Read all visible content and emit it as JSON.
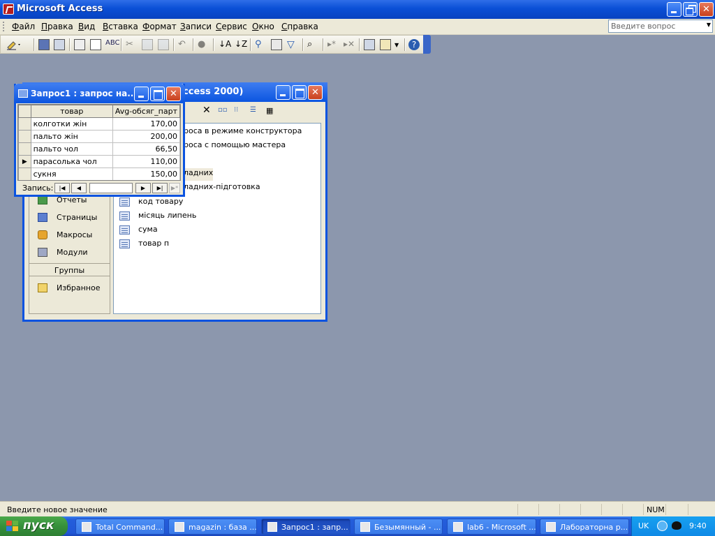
{
  "app": {
    "title": "Microsoft Access"
  },
  "menu": [
    "Файл",
    "Правка",
    "Вид",
    "Вставка",
    "Формат",
    "Записи",
    "Сервис",
    "Окно",
    "Справка"
  ],
  "help_box": {
    "placeholder": "Введите вопрос"
  },
  "db_window": {
    "title_fragment": "Access 2000)",
    "objects": [
      "Отчеты",
      "Страницы",
      "Макросы",
      "Модули"
    ],
    "groups_header": "Группы",
    "favorites": "Избранное",
    "list_fragments": [
      "роса в режиме конструктора",
      "роса с помощью мастера",
      "ладних",
      "ладних-підготовка"
    ],
    "queries": [
      "код товару",
      "місяць липень",
      "сума",
      "товар п"
    ]
  },
  "query_window": {
    "title": "Запрос1 : запрос на...",
    "columns": [
      "товар",
      "Avg-обсяг_парт"
    ],
    "rows": [
      {
        "name": "колготки жін",
        "value": "170,00"
      },
      {
        "name": "пальто жін",
        "value": "200,00"
      },
      {
        "name": "пальто чол",
        "value": "66,50"
      },
      {
        "name": "парасолька чол",
        "value": "110,00"
      },
      {
        "name": "сукня",
        "value": "150,00"
      }
    ],
    "current_row_marker": "▶",
    "nav_label": "Запись:",
    "record_value": ""
  },
  "statusbar": {
    "message": "Введите новое значение",
    "num": "NUM"
  },
  "taskbar": {
    "start": "пуск",
    "tasks": [
      "Total Command...",
      "magazin : база ...",
      "Запрос1 : запр...",
      "Безымянный - ...",
      "lab6 - Microsoft ...",
      "Лабораторна р..."
    ],
    "lang": "UK",
    "clock": "9:40"
  },
  "colors": {
    "title_blue": "#0a53e0",
    "desktop": "#8c97ad",
    "taskbar": "#245edb",
    "start_green": "#36903b"
  }
}
